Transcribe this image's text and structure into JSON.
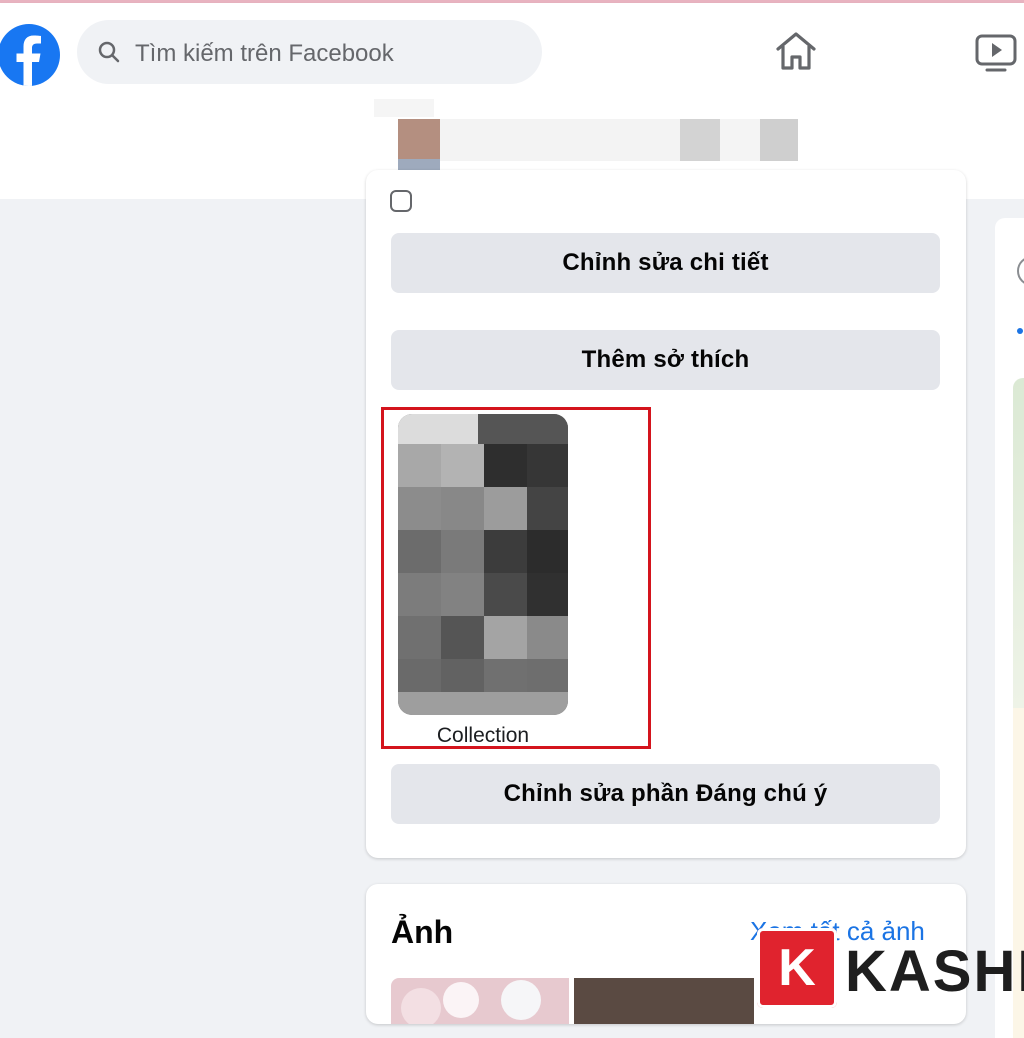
{
  "header": {
    "logo_icon": "facebook-logo-icon",
    "search_placeholder": "Tìm kiếm trên Facebook",
    "nav_icons": [
      "home-icon",
      "watch-icon"
    ]
  },
  "intro": {
    "edit_details_label": "Chỉnh sửa chi tiết",
    "add_hobbies_label": "Thêm sở thích",
    "featured_collection_label": "Collection",
    "edit_featured_label": "Chỉnh sửa phần Đáng chú ý"
  },
  "photos": {
    "title": "Ảnh",
    "see_all_label": "Xem tất cả ảnh"
  },
  "watermark": {
    "letter": "K",
    "brand": "KASHI"
  },
  "colors": {
    "facebook_blue": "#1877f2",
    "button_gray": "#e4e6eb",
    "link_blue": "#1b74e4",
    "highlight_red": "#d4141d",
    "watermark_red": "#e0232e"
  }
}
